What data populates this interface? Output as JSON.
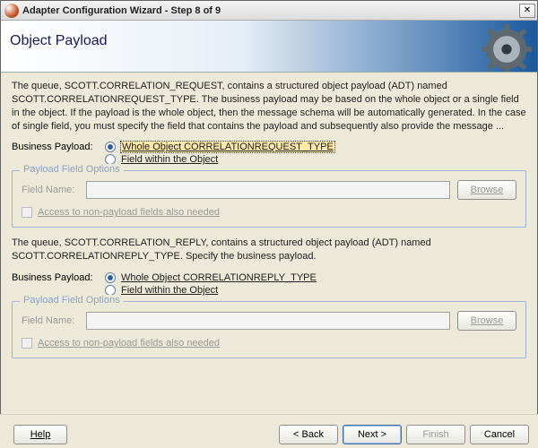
{
  "window": {
    "title": "Adapter Configuration Wizard - Step 8 of 9",
    "close_glyph": "✕"
  },
  "banner": {
    "heading": "Object Payload"
  },
  "section_request": {
    "description": "The queue, SCOTT.CORRELATION_REQUEST, contains a structured object payload (ADT) named SCOTT.CORRELATIONREQUEST_TYPE.  The business payload may be based on the whole object or a single field in the object. If the payload is the whole object, then the message schema will be automatically generated. In the case of single field, you must specify the field that contains the payload and subsequently also provide the message ...",
    "label": "Business Payload:",
    "radio_whole": "Whole Object CORRELATIONREQUEST_TYPE",
    "radio_field": "Field within the Object",
    "fieldset_legend": "Payload Field Options",
    "field_name_label": "Field Name:",
    "field_name_value": "",
    "browse_label": "Browse",
    "checkbox_label": "Access to non-payload fields also needed"
  },
  "section_reply": {
    "description": "The queue, SCOTT.CORRELATION_REPLY, contains a structured object payload (ADT) named SCOTT.CORRELATIONREPLY_TYPE.  Specify the business payload.",
    "label": "Business Payload:",
    "radio_whole": "Whole Object CORRELATIONREPLY_TYPE",
    "radio_field": "Field within the Object",
    "fieldset_legend": "Payload Field Options",
    "field_name_label": "Field Name:",
    "field_name_value": "",
    "browse_label": "Browse",
    "checkbox_label": "Access to non-payload fields also needed"
  },
  "footer": {
    "help": "Help",
    "back": "< Back",
    "next": "Next >",
    "finish": "Finish",
    "cancel": "Cancel"
  }
}
